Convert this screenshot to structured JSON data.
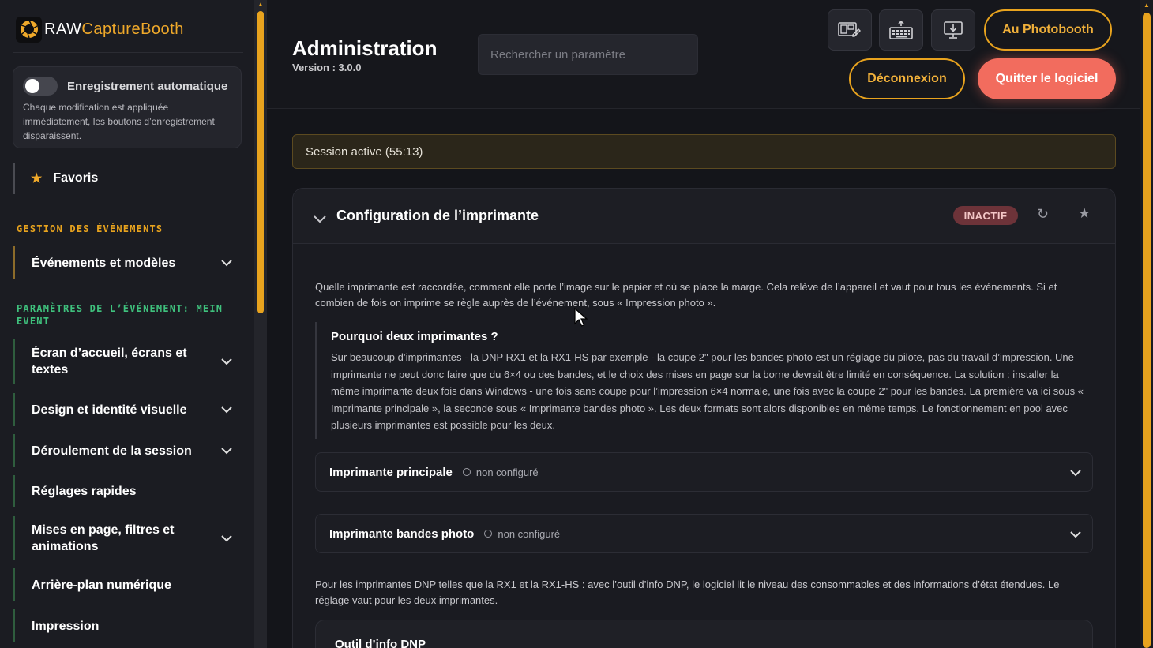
{
  "app": {
    "logo_raw": "RAW",
    "logo_capture": "CaptureBooth"
  },
  "sidebar": {
    "autosave": {
      "label": "Enregistrement automatique",
      "enabled": false,
      "description": "Chaque modification est appliquée immédiatement, les boutons d’enregistrement disparaissent."
    },
    "favorites_label": "Favoris",
    "section_events": "GESTION DES ÉVÉNEMENTS",
    "section_event_settings": "PARAMÈTRES DE L’ÉVÉNEMENT: MEIN EVENT",
    "items": [
      {
        "label": "Événements et modèles",
        "expandable": true
      },
      {
        "label": "Écran d’accueil, écrans et textes",
        "expandable": true
      },
      {
        "label": "Design et identité visuelle",
        "expandable": true
      },
      {
        "label": "Déroulement de la session",
        "expandable": true
      },
      {
        "label": "Réglages rapides",
        "expandable": false
      },
      {
        "label": "Mises en page, filtres et animations",
        "expandable": true
      },
      {
        "label": "Arrière-plan numérique",
        "expandable": false
      },
      {
        "label": "Impression",
        "expandable": false
      }
    ]
  },
  "header": {
    "title": "Administration",
    "version": "Version : 3.0.0",
    "search_placeholder": "Rechercher un paramètre",
    "icon_buttons": [
      "layout-edit-icon",
      "keyboard-icon",
      "monitor-download-icon"
    ],
    "photobooth_label": "Au Photobooth",
    "logout_label": "Déconnexion",
    "quit_label": "Quitter le logiciel"
  },
  "session_banner": "Session active (55:13)",
  "printer_card": {
    "title": "Configuration de l’imprimante",
    "badge": "INACTIF",
    "intro": "Quelle imprimante est raccordée, comment elle porte l’image sur le papier et où se place la marge. Cela relève de l’appareil et vaut pour tous les événements. Si et combien de fois on imprime se règle auprès de l’événement, sous « Impression photo ».",
    "why_title": "Pourquoi deux imprimantes ?",
    "why_text": "Sur beaucoup d’imprimantes - la DNP RX1 et la RX1-HS par exemple - la coupe 2\" pour les bandes photo est un réglage du pilote, pas du travail d’impression. Une imprimante ne peut donc faire que du 6×4 ou des bandes, et le choix des mises en page sur la borne devrait être limité en conséquence. La solution : installer la même imprimante deux fois dans Windows - une fois sans coupe pour l’impression 6×4 normale, une fois avec la coupe 2\" pour les bandes. La première va ici sous « Imprimante principale », la seconde sous « Imprimante bandes photo ». Les deux formats sont alors disponibles en même temps. Le fonctionnement en pool avec plusieurs imprimantes est possible pour les deux.",
    "printers": [
      {
        "name": "Imprimante principale",
        "status": "non configuré"
      },
      {
        "name": "Imprimante bandes photo",
        "status": "non configuré"
      }
    ],
    "dnp_text": "Pour les imprimantes DNP telles que la RX1 et la RX1-HS : avec l’outil d’info DNP, le logiciel lit le niveau des consommables et des informations d’état étendues. Le réglage vaut pour les deux imprimantes.",
    "dnp_title": "Outil d’info DNP"
  },
  "colors": {
    "accent": "#e8a31e",
    "danger": "#f26c5e",
    "section_green": "#3fc17d"
  }
}
